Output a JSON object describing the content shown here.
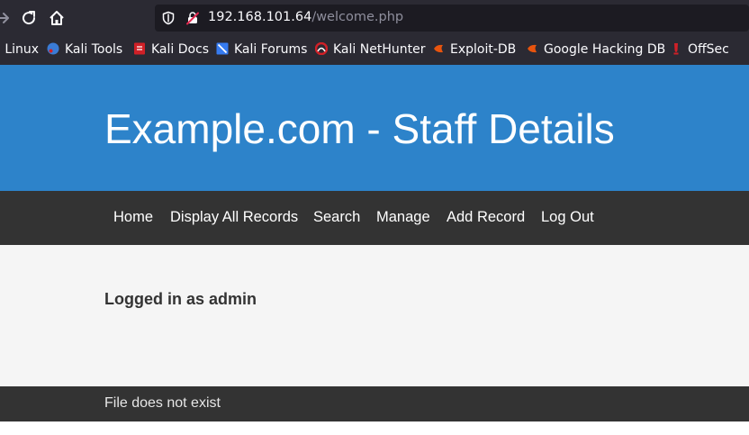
{
  "browser": {
    "url_host": "192.168.101.64",
    "url_path": "/welcome.php",
    "bookmarks": [
      {
        "label": "i Linux",
        "icon": "kali-linux-icon",
        "color": "#367bf0"
      },
      {
        "label": "Kali Tools",
        "icon": "kali-tools-icon",
        "color": "#3a7bd5"
      },
      {
        "label": "Kali Docs",
        "icon": "kali-docs-icon",
        "color": "#d02027"
      },
      {
        "label": "Kali Forums",
        "icon": "kali-forums-icon",
        "color": "#367bf0"
      },
      {
        "label": "Kali NetHunter",
        "icon": "kali-nethunter-icon",
        "color": "#d02027"
      },
      {
        "label": "Exploit-DB",
        "icon": "exploit-db-icon",
        "color": "#e8540e"
      },
      {
        "label": "Google Hacking DB",
        "icon": "google-hacking-db-icon",
        "color": "#e8540e"
      },
      {
        "label": "OffSec",
        "icon": "offsec-icon",
        "color": "#d02027"
      }
    ]
  },
  "header": {
    "title": "Example.com - Staff Details"
  },
  "menu": {
    "items": [
      "Home",
      "Display All Records",
      "Search",
      "Manage",
      "Add Record",
      "Log Out"
    ]
  },
  "content": {
    "status": "Logged in as admin"
  },
  "footer": {
    "message": "File does not exist"
  }
}
